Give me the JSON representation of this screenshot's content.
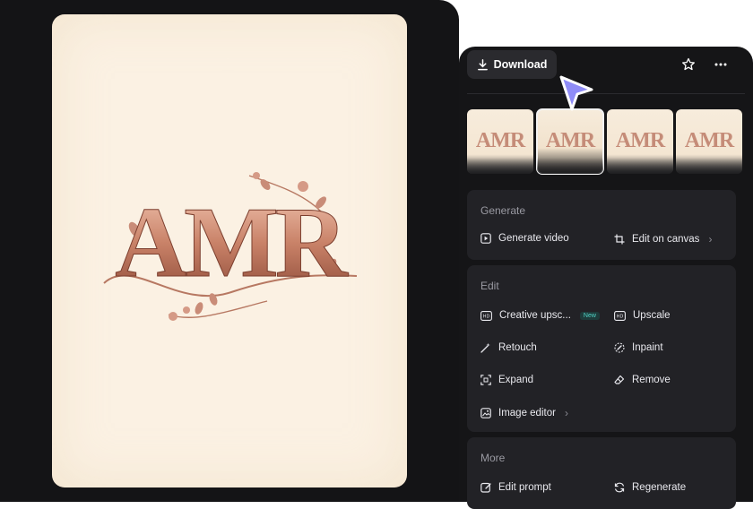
{
  "artwork": {
    "letters": "AMR"
  },
  "toolbar": {
    "download_label": "Download",
    "favorite_icon": "star-icon",
    "more_icon": "more-horizontal-icon"
  },
  "thumbnails": [
    {
      "text": "AMR",
      "selected": false
    },
    {
      "text": "AMR",
      "selected": true
    },
    {
      "text": "AMR",
      "selected": false
    },
    {
      "text": "AMR",
      "selected": false
    }
  ],
  "sections": {
    "generate": {
      "title": "Generate",
      "generate_video": "Generate video",
      "edit_on_canvas": "Edit on canvas"
    },
    "edit": {
      "title": "Edit",
      "creative_upscale": "Creative upsc...",
      "new_badge": "New",
      "upscale": "Upscale",
      "retouch": "Retouch",
      "inpaint": "Inpaint",
      "expand": "Expand",
      "remove": "Remove",
      "image_editor": "Image editor"
    },
    "more": {
      "title": "More",
      "edit_prompt": "Edit prompt",
      "regenerate": "Regenerate"
    }
  },
  "colors": {
    "accent_cursor": "#8f8cf7",
    "panel": "#151517",
    "card": "#222226",
    "badge_text": "#52d5c8"
  }
}
